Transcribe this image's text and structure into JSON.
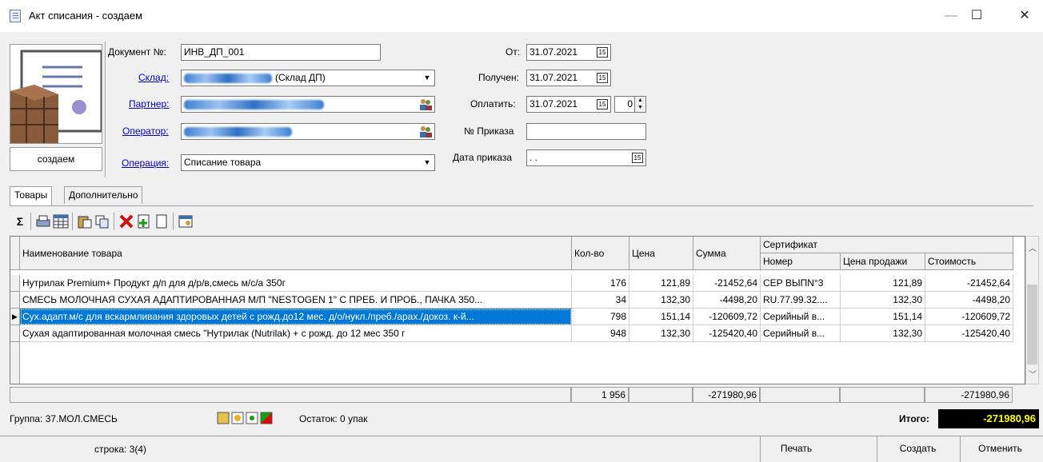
{
  "window": {
    "title": "Акт списания - создаем",
    "min_glyph": "—",
    "max_glyph": "☐",
    "close_glyph": "✕"
  },
  "status_box": "создаем",
  "form": {
    "doc_no_label": "Документ №:",
    "doc_no_value": "ИНВ_ДП_001",
    "warehouse_label": "Склад:",
    "warehouse_value_suffix": "(Склад ДП)",
    "partner_label": "Партнер:",
    "operator_label": "Оператор:",
    "operation_label": "Операция:",
    "operation_value": "Списание товара",
    "from_label": "От:",
    "from_value": "31.07.2021",
    "received_label": "Получен:",
    "received_value": "31.07.2021",
    "pay_label": "Оплатить:",
    "pay_value": "31.07.2021",
    "pay_days": "0",
    "order_no_label": "№ Приказа",
    "order_no_value": "",
    "order_date_label": "Дата приказа",
    "order_date_value": " .  .",
    "date_btn_glyph": "15"
  },
  "tabs": [
    "Товары",
    "Дополнительно"
  ],
  "toolbar": {
    "sum_glyph": "Σ"
  },
  "grid": {
    "headers": {
      "name": "Наименование товара",
      "qty": "Кол-во",
      "price": "Цена",
      "sum": "Сумма",
      "cert": "Сертификат",
      "cert_no": "Номер",
      "sale_price": "Цена продажи",
      "cost": "Стоимость"
    },
    "rows": [
      {
        "name": "Нутрилак Premium+ Продукт д/п для д/р/в,смесь м/с/а 350г",
        "qty": "176",
        "price": "121,89",
        "sum": "-21452,64",
        "cert": "СЕР ВЫПN°3",
        "sale_price": "121,89",
        "cost": "-21452,64"
      },
      {
        "name": "СМЕСЬ МОЛОЧНАЯ СУХАЯ АДАПТИРОВАННАЯ М/П \"NESTOGEN 1\" С ПРЕБ. И ПРОБ., ПАЧКА 350...",
        "qty": "34",
        "price": "132,30",
        "sum": "-4498,20",
        "cert": "RU.77.99.32....",
        "sale_price": "132,30",
        "cost": "-4498,20"
      },
      {
        "name": "Сух.адапт.м/с для вскармливания здоровых детей с рожд.до12 мес. д/о/нукл./преб./арах./докоз. к-й...",
        "qty": "798",
        "price": "151,14",
        "sum": "-120609,72",
        "cert": "Серийный в...",
        "sale_price": "151,14",
        "cost": "-120609,72"
      },
      {
        "name": "Сухая адаптированная молочная смесь \"Нутрилак (Nutrilak) + с рожд. до 12 мес 350 г",
        "qty": "948",
        "price": "132,30",
        "sum": "-125420,40",
        "cert": "Серийный в...",
        "sale_price": "132,30",
        "cost": "-125420,40"
      }
    ],
    "totals": {
      "qty": "1 956",
      "sum": "-271980,96",
      "cost": "-271980,96"
    }
  },
  "footer": {
    "group": "Группа:  37.МОЛ.СМЕСЬ",
    "remainder": "Остаток: 0 упак",
    "total_label": "Итого:",
    "total_value": "-271980,96",
    "row_info": "строка: 3(4)",
    "print": "Печать",
    "create": "Создать",
    "cancel": "Отменить"
  }
}
